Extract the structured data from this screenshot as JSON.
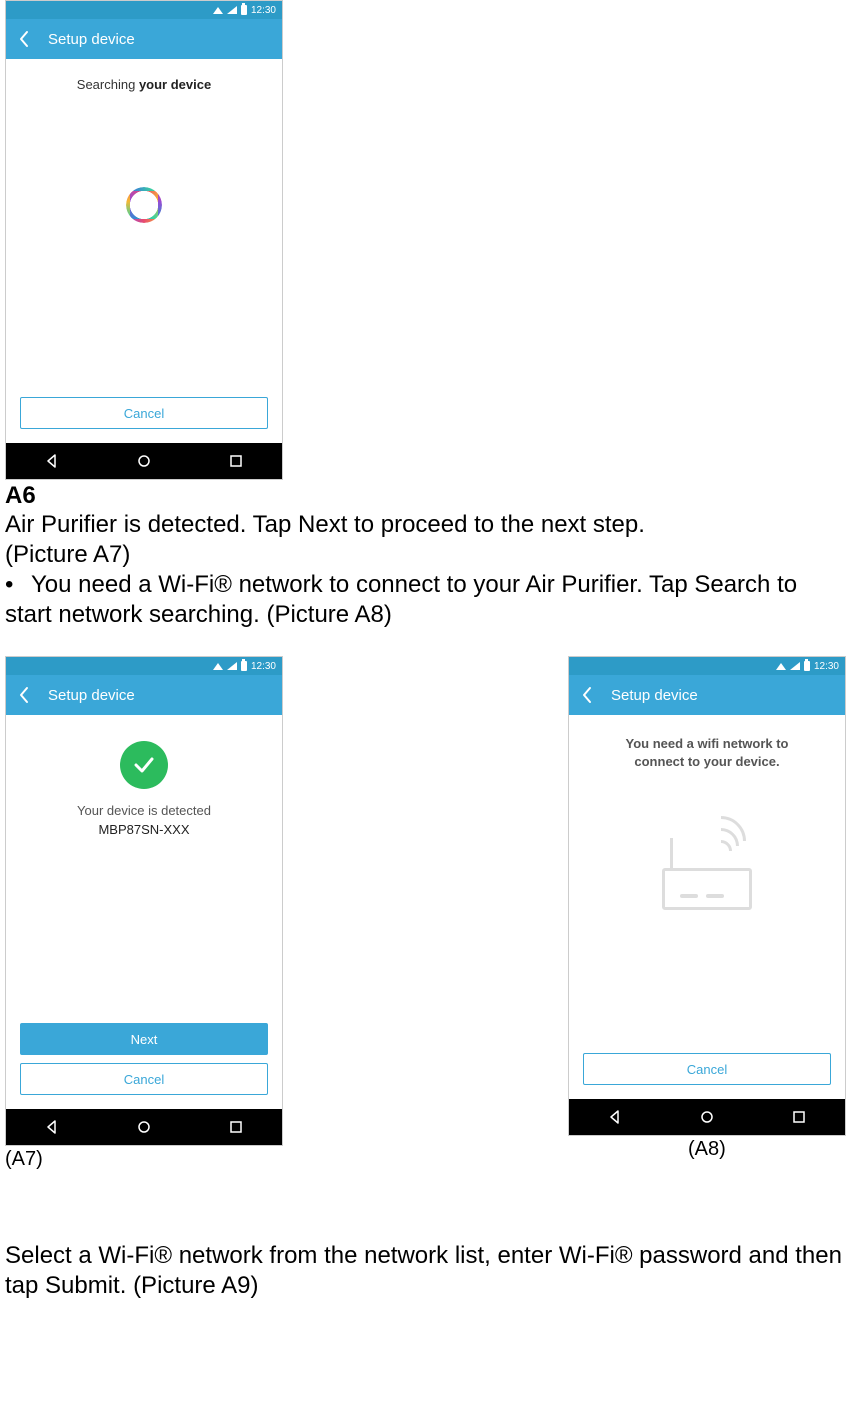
{
  "status_time": "12:30",
  "screen_a6": {
    "title": "Setup device",
    "searching_prefix": "Searching ",
    "searching_bold": "your device",
    "cancel": "Cancel"
  },
  "label_a6": "A6",
  "para1_line1": "Air Purifier is detected. Tap Next to proceed to the next step.",
  "para1_line2": "(Picture A7)",
  "bullet1": "You need a Wi-Fi® network to connect to your Air Purifier. Tap Search to start network searching. (Picture A8)",
  "screen_a7": {
    "title": "Setup device",
    "detected": "Your device is detected",
    "device_id": "MBP87SN-XXX",
    "next": "Next",
    "cancel": "Cancel"
  },
  "screen_a8": {
    "title": "Setup device",
    "msg_line1": "You need a wifi network to",
    "msg_line2": "connect to your device.",
    "cancel": "Cancel"
  },
  "caption_a7": "(A7)",
  "caption_a8": "(A8)",
  "para2": "Select a Wi-Fi® network from the network list, enter Wi-Fi® password and then tap Submit. (Picture A9)"
}
